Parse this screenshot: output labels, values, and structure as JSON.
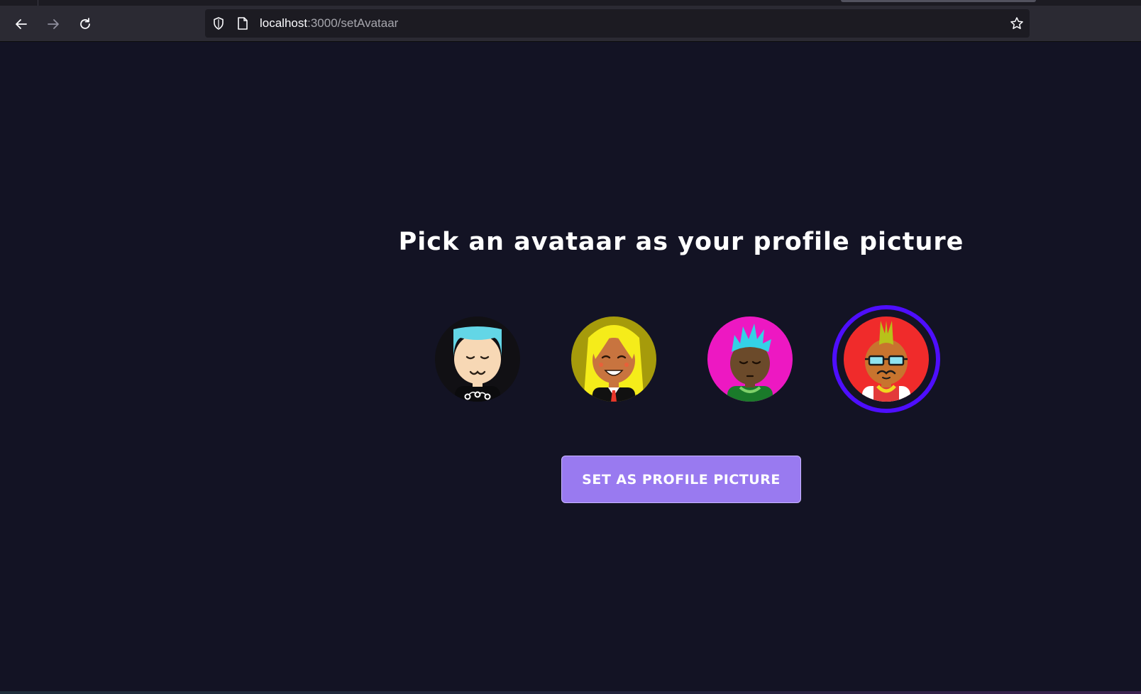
{
  "browser": {
    "url_host": "localhost",
    "url_path": ":3000/setAvataar",
    "icons": [
      "back-arrow-icon",
      "forward-arrow-icon",
      "reload-icon",
      "shield-icon",
      "page-icon",
      "bookmark-star-icon"
    ]
  },
  "page": {
    "title": "Pick an avataar as your profile picture",
    "button_label": "SET AS PROFILE PICTURE",
    "selected_avatar_index": 3
  },
  "colors": {
    "background": "#131324",
    "button": "#997af0",
    "selected_ring": "#4e0eff"
  }
}
